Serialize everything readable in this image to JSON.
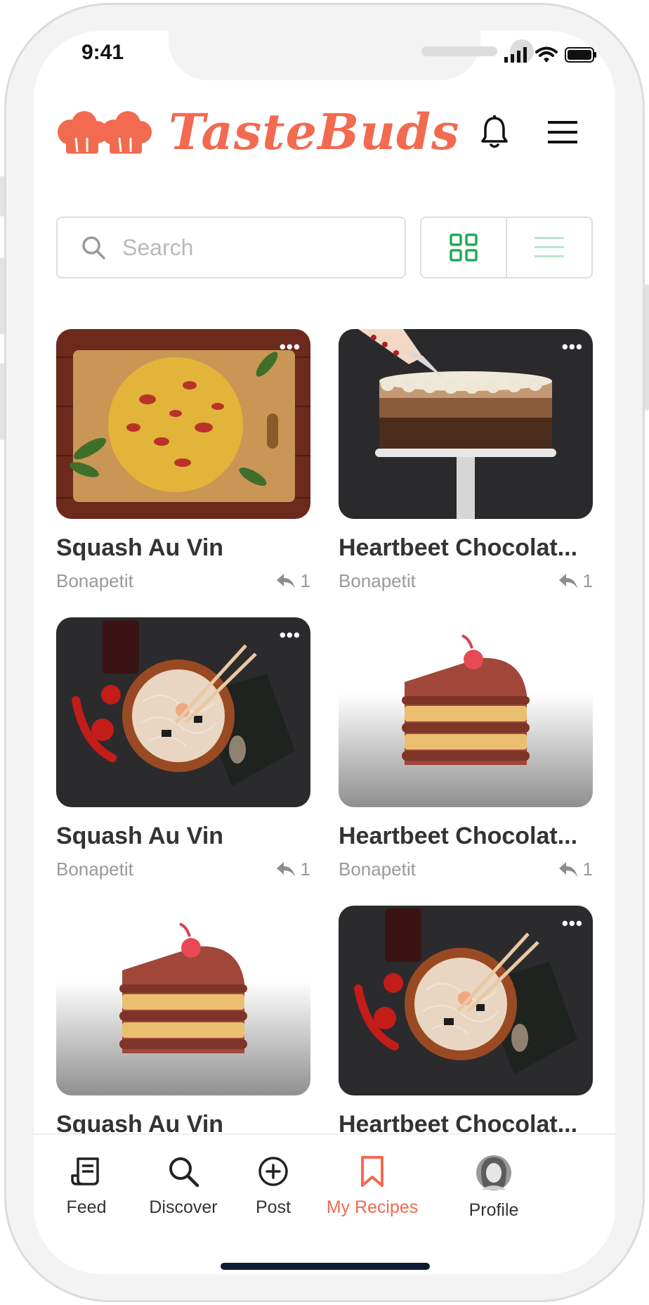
{
  "status": {
    "time": "9:41"
  },
  "brand": {
    "name": "TasteBuds",
    "accent": "#f26a50"
  },
  "search": {
    "placeholder": "Search"
  },
  "view_toggle": {
    "active": "grid",
    "icons": [
      "grid-icon",
      "list-icon"
    ],
    "active_color": "#1faa5a",
    "inactive_color": "#b8e6cc"
  },
  "recipes": [
    {
      "title": "Squash Au Vin",
      "author": "Bonapetit",
      "shares": "1",
      "image": "frittata-photo"
    },
    {
      "title": "Heartbeet Chocolat...",
      "author": "Bonapetit",
      "shares": "1",
      "image": "layer-cake-photo"
    },
    {
      "title": "Squash Au Vin",
      "author": "Bonapetit",
      "shares": "1",
      "image": "noodle-bowl-photo"
    },
    {
      "title": "Heartbeet Chocolat...",
      "author": "Bonapetit",
      "shares": "1",
      "image": "cake-placeholder"
    },
    {
      "title": "Squash Au Vin",
      "author": "",
      "shares": "",
      "image": "cake-placeholder"
    },
    {
      "title": "Heartbeet Chocolat...",
      "author": "",
      "shares": "",
      "image": "noodle-bowl-photo"
    }
  ],
  "tabs": [
    {
      "label": "Feed",
      "icon": "feed-icon"
    },
    {
      "label": "Discover",
      "icon": "search-icon"
    },
    {
      "label": "Post",
      "icon": "plus-circle-icon"
    },
    {
      "label": "My Recipes",
      "icon": "bookmark-icon",
      "active": true
    },
    {
      "label": "Profile",
      "icon": "avatar"
    }
  ]
}
